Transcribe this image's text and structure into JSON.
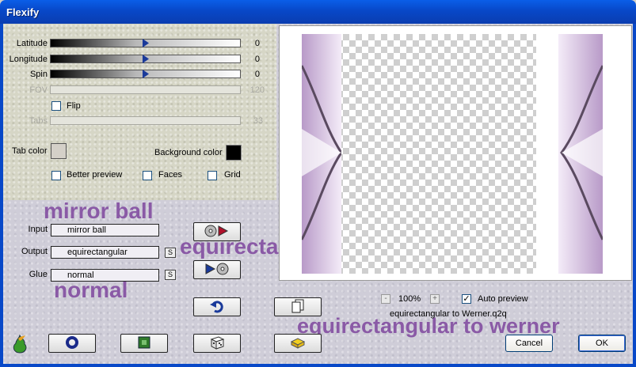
{
  "window": {
    "title": "Flexify"
  },
  "sliders": [
    {
      "label": "Latitude",
      "value": "0",
      "level": 0.5,
      "disabled": false
    },
    {
      "label": "Longitude",
      "value": "0",
      "level": 0.5,
      "disabled": false
    },
    {
      "label": "Spin",
      "value": "0",
      "level": 0.5,
      "disabled": false
    },
    {
      "label": "FOV",
      "value": "120",
      "disabled": true
    }
  ],
  "flip": {
    "label": "Flip",
    "checked": false
  },
  "tabs": {
    "label": "Tabs",
    "value": "33",
    "disabled": true
  },
  "tab_color": {
    "label": "Tab color",
    "color": "#d4d0c8"
  },
  "background_color": {
    "label": "Background color",
    "color": "#000000"
  },
  "options": {
    "better_preview": {
      "label": "Better preview",
      "checked": false
    },
    "faces": {
      "label": "Faces",
      "checked": false
    },
    "grid": {
      "label": "Grid",
      "checked": false
    }
  },
  "projection": {
    "input_label": "Input",
    "input_value": "mirror ball",
    "output_label": "Output",
    "output_value": "equirectangular",
    "glue_label": "Glue",
    "glue_value": "normal",
    "small_button": "S"
  },
  "overlays": {
    "input": "mirror ball",
    "output": "equirectangular",
    "glue": "normal",
    "preset": "equirectangular to werner"
  },
  "preview": {
    "zoom_minus": "-",
    "zoom": "100%",
    "zoom_plus": "+",
    "auto_preview_label": "Auto preview",
    "auto_preview_checked": true,
    "preset_file": "equirectangular to Werner.q2q"
  },
  "buttons": {
    "cancel": "Cancel",
    "ok": "OK"
  },
  "icons": {
    "swap_input": "disc-arrow-icon",
    "swap_output": "arrow-disc-icon",
    "reset": "undo-icon",
    "copy": "copy-icon",
    "logo": "flaming-pear-icon",
    "tool1": "ring-icon",
    "tool2": "square-icon",
    "tool3": "dice-icon",
    "tool4": "folder-icon"
  },
  "colors": {
    "overlay_text": "#8a5aa6",
    "titlebar": "#0848c8"
  }
}
